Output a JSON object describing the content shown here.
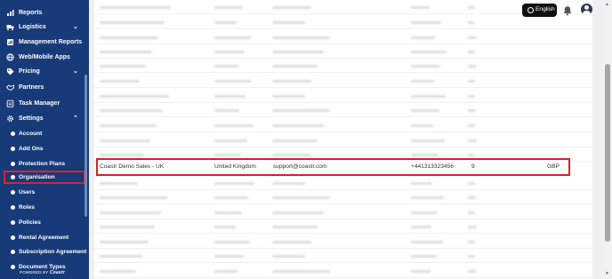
{
  "sidebar": {
    "nav": [
      {
        "label": "Reports",
        "icon": "bar-chart-icon",
        "chevron": ""
      },
      {
        "label": "Logistics",
        "icon": "truck-icon",
        "chevron": "⌄"
      },
      {
        "label": "Management Reports",
        "icon": "report-icon",
        "chevron": ""
      },
      {
        "label": "Web/Mobile Apps",
        "icon": "globe-icon",
        "chevron": ""
      },
      {
        "label": "Pricing",
        "icon": "tag-icon",
        "chevron": "⌄"
      },
      {
        "label": "Partners",
        "icon": "handshake-icon",
        "chevron": ""
      },
      {
        "label": "Task Manager",
        "icon": "clipboard-icon",
        "chevron": ""
      },
      {
        "label": "Settings",
        "icon": "gear-icon",
        "chevron": "⌃"
      }
    ],
    "settings_items": [
      {
        "label": "Account"
      },
      {
        "label": "Add Ons"
      },
      {
        "label": "Protection Plans"
      },
      {
        "label": "Organisation"
      },
      {
        "label": "Users"
      },
      {
        "label": "Roles"
      },
      {
        "label": "Policies"
      },
      {
        "label": "Rental Agreement"
      },
      {
        "label": "Subscription Agreement"
      },
      {
        "label": "Document Types"
      }
    ],
    "powered_prefix": "POWERED BY",
    "powered_brand": "Coastr"
  },
  "header": {
    "language_label": "English"
  },
  "highlighted_row": {
    "name": "Coastr Demo Sales - UK",
    "country": "United Kingdom",
    "email": "support@coastr.com",
    "phone": "+441313323456",
    "count": "9",
    "currency": "GBP"
  },
  "colors": {
    "sidebar_bg": "#173a78",
    "highlight_border": "#d8202a"
  }
}
